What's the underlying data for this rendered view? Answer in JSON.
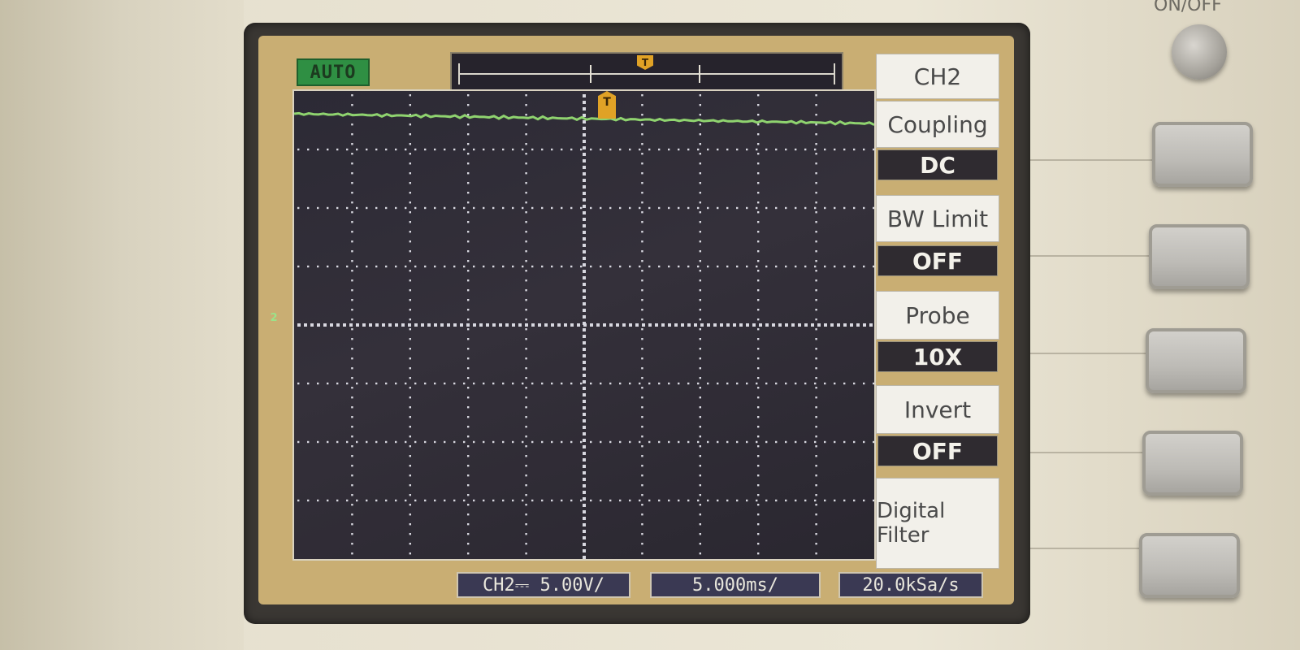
{
  "device": {
    "power_label": "ON/OFF"
  },
  "screen": {
    "trigger_mode": "AUTO",
    "trigger_symbol": "T",
    "channel_reference": "2",
    "menu": {
      "title": "CH2",
      "items": [
        {
          "label": "Coupling",
          "value": "DC"
        },
        {
          "label": "BW Limit",
          "value": "OFF"
        },
        {
          "label": "Probe",
          "value": "10X"
        },
        {
          "label": "Invert",
          "value": "OFF"
        },
        {
          "label": "Digital Filter",
          "value": ""
        }
      ]
    },
    "status": {
      "channel_scale": "CH2⎓ 5.00V/",
      "time_base": "5.000ms/",
      "sample_rate": "20.0kSa/s"
    },
    "colors": {
      "trace": "#8fd36f",
      "trigger": "#e0a226",
      "grid_background": "#2c2a35",
      "menu_value_background": "#2f2b30"
    }
  }
}
